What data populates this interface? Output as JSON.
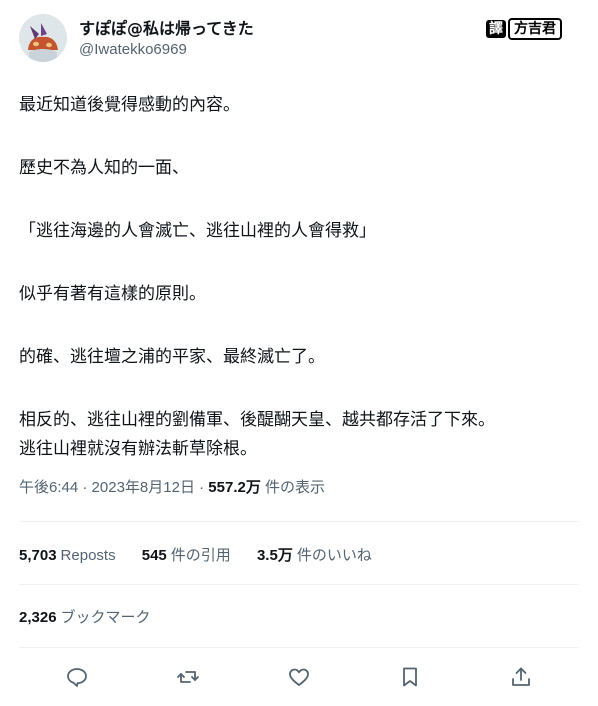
{
  "author": {
    "name": "すぽぽ@私は帰ってきた",
    "handle": "@Iwatekko6969"
  },
  "watermark": {
    "prefix": "譯",
    "suffix": "方吉君"
  },
  "tweet": {
    "lines": [
      "最近知道後覺得感動的內容。",
      "歷史不為人知的一面、",
      "「逃往海邊的人會滅亡、逃往山裡的人會得救」",
      "似乎有著有這樣的原則。",
      "的確、逃往壇之浦的平家、最終滅亡了。",
      "相反的、逃往山裡的劉備軍、後醍醐天皇、越共都存活了下來。",
      "逃往山裡就沒有辦法斬草除根。"
    ]
  },
  "meta": {
    "time": "午後6:44",
    "date": "2023年8月12日",
    "views_count": "557.2万",
    "views_label": "件の表示"
  },
  "stats": {
    "reposts_count": "5,703",
    "reposts_label": "Reposts",
    "quotes_count": "545",
    "quotes_label": "件の引用",
    "likes_count": "3.5万",
    "likes_label": "件のいいね"
  },
  "bookmarks": {
    "count": "2,326",
    "label": "ブックマーク"
  },
  "actions": {
    "reply_icon": "reply-icon",
    "repost_icon": "repost-icon",
    "like_icon": "heart-icon",
    "bookmark_icon": "bookmark-icon",
    "share_icon": "share-icon"
  }
}
